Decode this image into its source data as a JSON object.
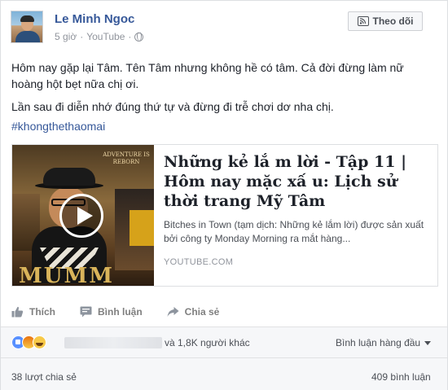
{
  "post": {
    "author": "Le Minh Ngoc",
    "time": "5 giờ",
    "via": "YouTube",
    "separator": "·",
    "follow_label": "Theo dõi",
    "text_line_1": "Hôm nay gặp lại Tâm. Tên Tâm nhưng không hề có tâm. Cả đời đừng làm nữ hoàng hột bẹt nữa chị ơi.",
    "text_line_2": "Lần sau đi diễn nhớ đúng thứ tự và đừng đi trễ chơi dơ nha chị.",
    "hashtag": "#khongthethaomai"
  },
  "link_preview": {
    "title": "Những kẻ lắ m lời - Tập 11 | Hôm nay mặc xấ u: Lịch sử thời trang Mỹ Tâm",
    "description": "Bitches in Town (tạm dịch: Những kẻ lắm lời) được sản xuất bởi công ty Monday Morning ra mắt hàng...",
    "domain": "YOUTUBE.COM",
    "thumbnail_caption_top": "ADVENTURE IS REBORN",
    "thumbnail_caption_bottom": "MUMM"
  },
  "actions": {
    "like": "Thích",
    "comment": "Bình luận",
    "share": "Chia sẻ"
  },
  "footer": {
    "reactions_others": "và 1,8K người khác",
    "sort_label": "Bình luận hàng đầu",
    "shares_count": "38 lượt chia sẻ",
    "comments_count": "409 bình luận"
  },
  "icons": {
    "follow": "rss-icon",
    "globe": "globe-icon",
    "like": "thumbs-up-icon",
    "comment": "comment-icon",
    "share": "share-arrow-icon",
    "play": "play-icon"
  },
  "colors": {
    "link_blue": "#365899",
    "muted": "#90949c",
    "action_gray": "#7f7f7f",
    "footer_bg": "#f6f7f9"
  }
}
